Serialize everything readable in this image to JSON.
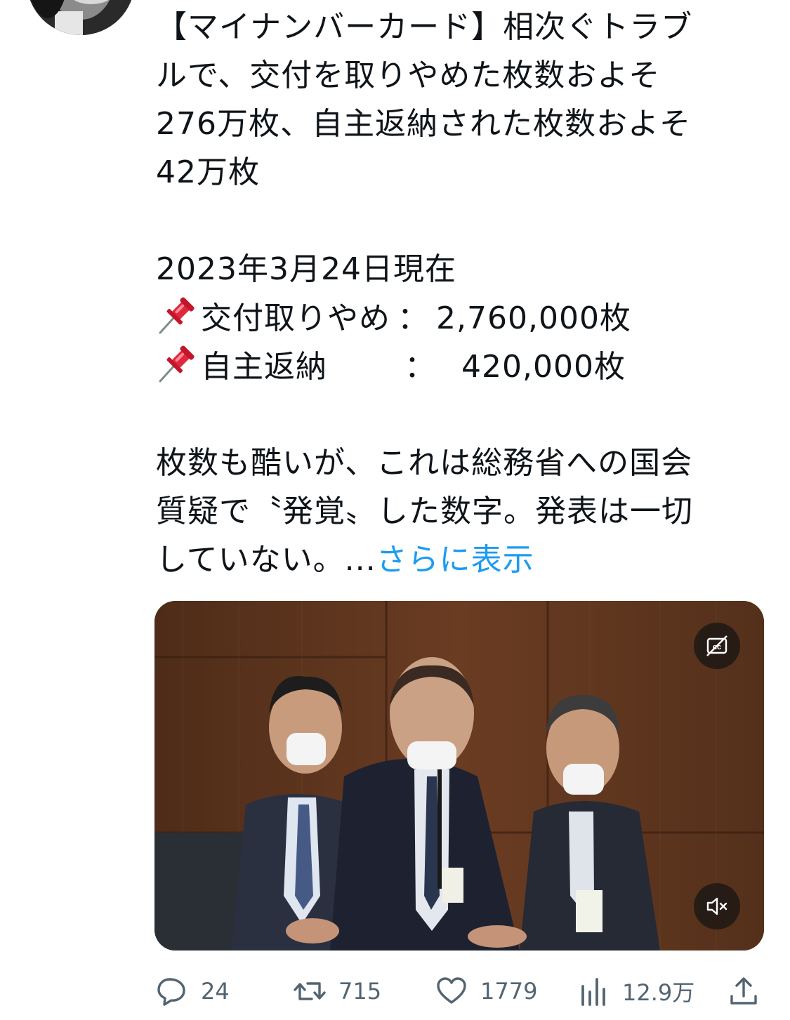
{
  "tweet": {
    "lines": [
      "【マイナンバーカード】相次ぐトラブ",
      "ルで、交付を取りやめた枚数およそ",
      "276万枚、自主返納された枚数およそ",
      "42万枚",
      "2023年3月24日現在"
    ],
    "pin_rows": [
      {
        "icon": "pushpin-icon",
        "label": "交付取りやめ",
        "colon": "：",
        "value": "2,760,000枚"
      },
      {
        "icon": "pushpin-icon",
        "label": "自主返納",
        "colon": "：",
        "value": "420,000枚"
      }
    ],
    "body_lines": [
      "枚数も酷いが、これは総務省への国会",
      "質疑で〝発覚〟した数字。発表は一切",
      "していない。..."
    ],
    "show_more": "さらに表示"
  },
  "media": {
    "type": "video",
    "controls": {
      "captions_icon": "captions-off-icon",
      "mute_icon": "muted-speaker-icon"
    }
  },
  "actions": {
    "reply": {
      "icon": "reply-bubble-icon",
      "count": "24"
    },
    "retweet": {
      "icon": "retweet-icon",
      "count": "715"
    },
    "like": {
      "icon": "heart-icon",
      "count": "1779"
    },
    "views": {
      "icon": "views-bar-chart-icon",
      "count": "12.9万"
    },
    "share": {
      "icon": "share-upload-icon"
    }
  },
  "colors": {
    "text": "#0f1419",
    "secondary": "#536471",
    "link": "#1d9bf0",
    "pin": "#e0283c"
  }
}
